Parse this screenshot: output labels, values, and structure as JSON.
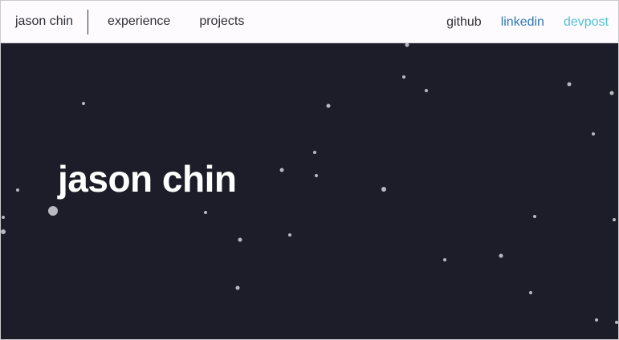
{
  "header": {
    "brand": "jason chin",
    "nav": [
      {
        "label": "experience"
      },
      {
        "label": "projects"
      }
    ],
    "social": [
      {
        "label": "github",
        "color": "#2f3036"
      },
      {
        "label": "linkedin",
        "color": "#2f79b3"
      },
      {
        "label": "devpost",
        "color": "#4fc1d6"
      }
    ]
  },
  "hero": {
    "title": "jason chin",
    "background_color": "#1c1d28",
    "particle_color": "#b9b9c2"
  }
}
